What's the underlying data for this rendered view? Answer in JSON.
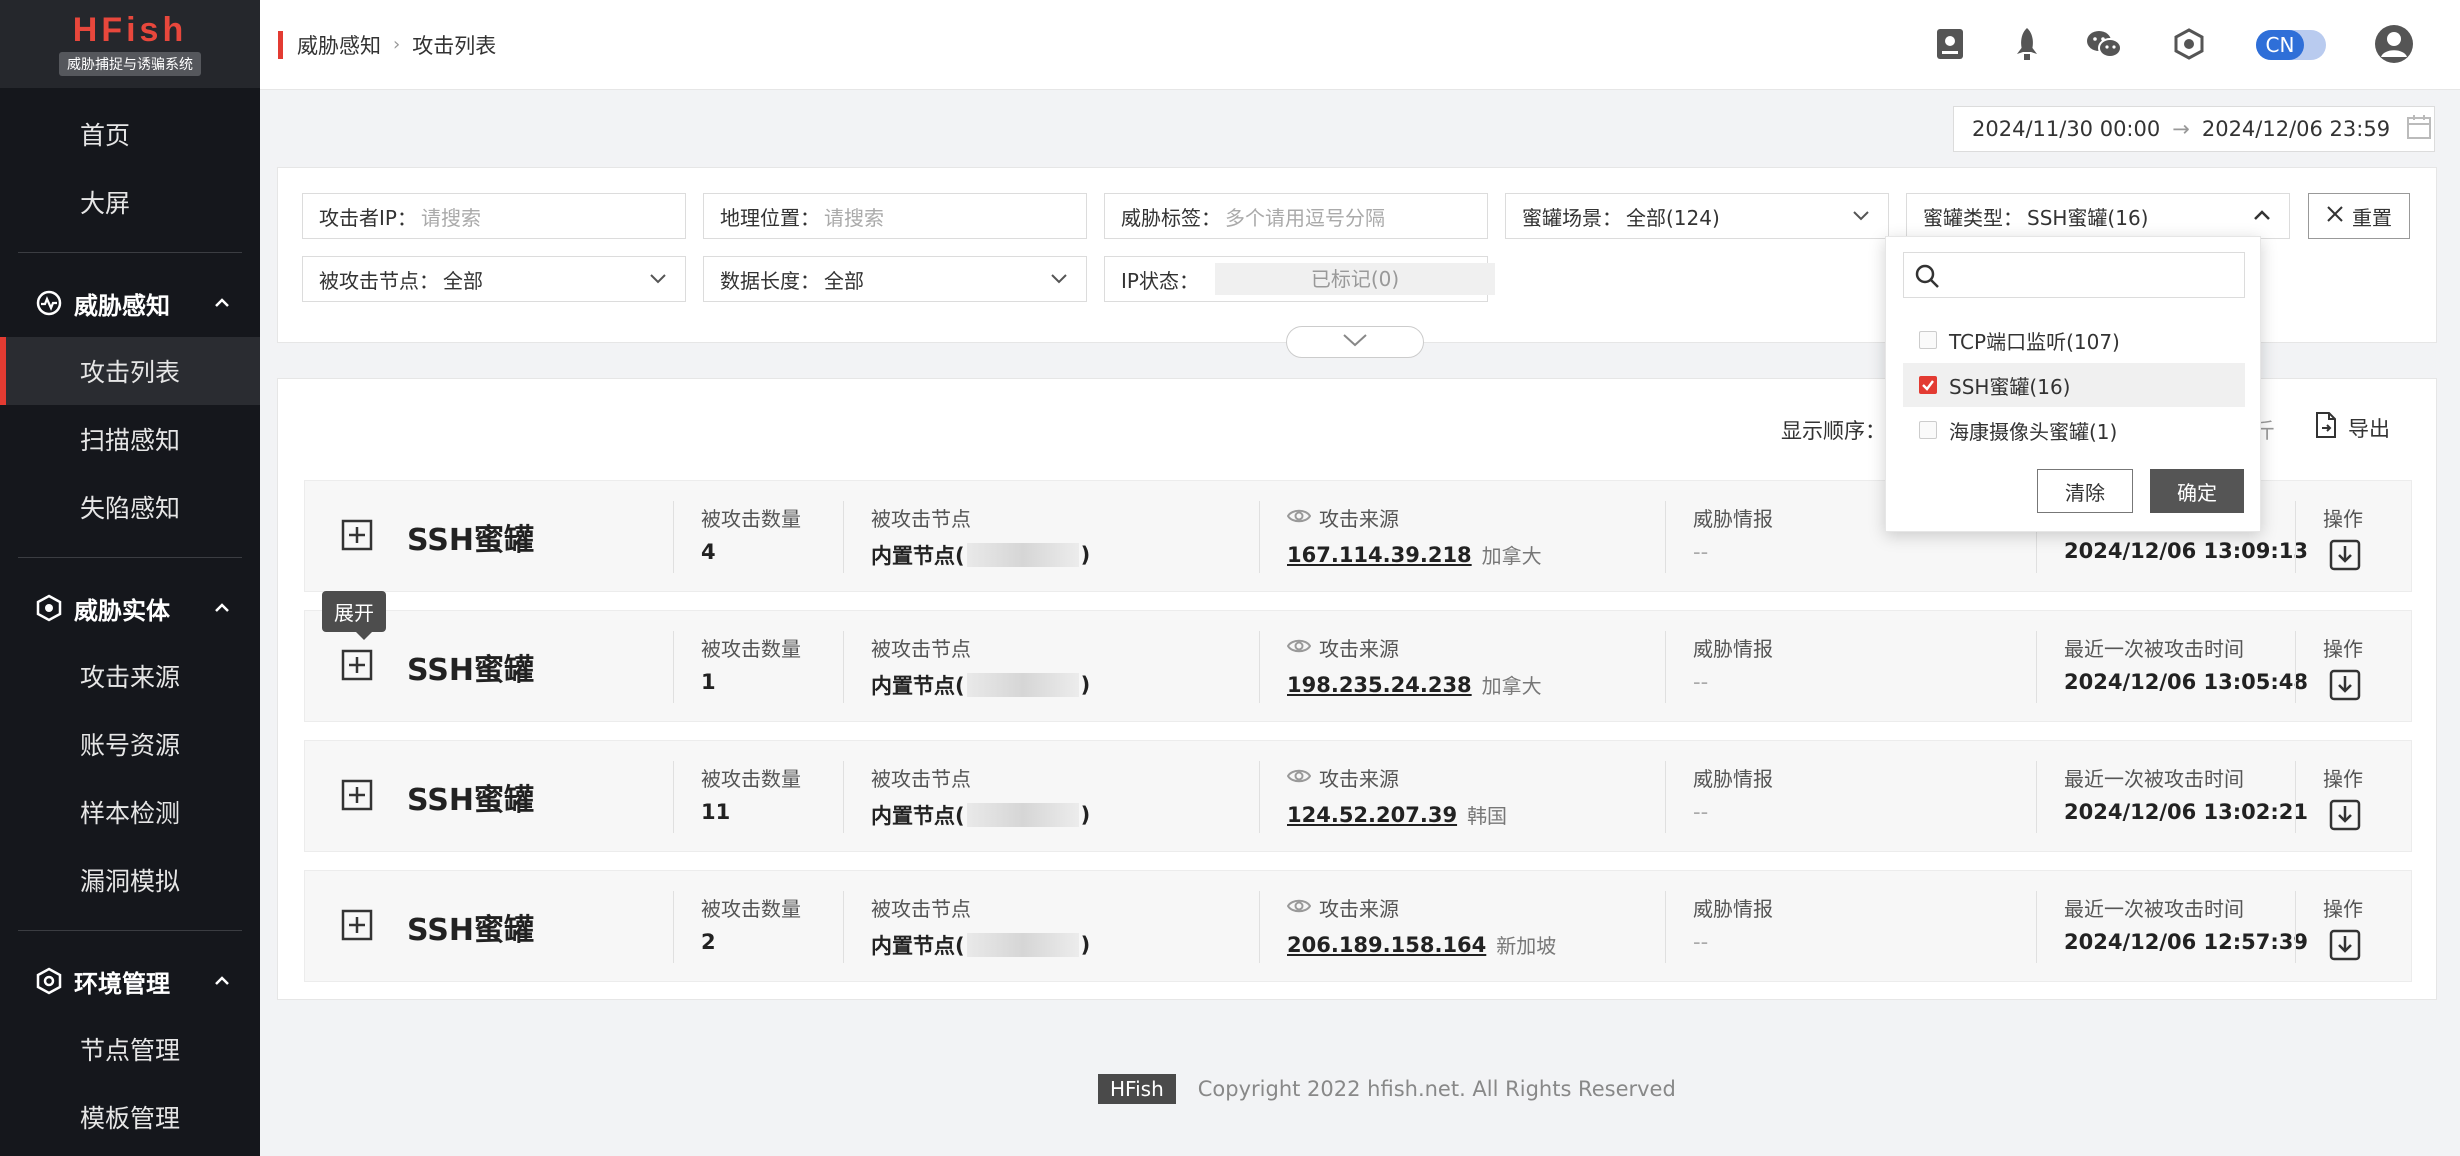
{
  "brand": {
    "title": "HFish",
    "subtitle": "威胁捕捉与诱骗系统"
  },
  "sidebar": {
    "top_items": [
      {
        "label": "首页"
      },
      {
        "label": "大屏"
      }
    ],
    "groups": [
      {
        "label": "威胁感知",
        "items": [
          {
            "label": "攻击列表",
            "active": true
          },
          {
            "label": "扫描感知"
          },
          {
            "label": "失陷感知"
          }
        ]
      },
      {
        "label": "威胁实体",
        "items": [
          {
            "label": "攻击来源"
          },
          {
            "label": "账号资源"
          },
          {
            "label": "样本检测"
          },
          {
            "label": "漏洞模拟"
          }
        ]
      },
      {
        "label": "环境管理",
        "items": [
          {
            "label": "节点管理"
          },
          {
            "label": "模板管理"
          }
        ]
      }
    ]
  },
  "header": {
    "breadcrumb": [
      "威胁感知",
      "攻击列表"
    ],
    "lang": "CN",
    "icons": [
      "manual-icon",
      "rocket-icon",
      "wechat-icon",
      "hexagon-settings-icon",
      "user-avatar-icon"
    ]
  },
  "date_range": {
    "start": "2024/11/30 00:00",
    "end": "2024/12/06 23:59"
  },
  "filters": {
    "attacker_ip": {
      "label": "攻击者IP：",
      "placeholder": "请搜索"
    },
    "geo": {
      "label": "地理位置：",
      "placeholder": "请搜索"
    },
    "threat_tag": {
      "label": "威胁标签：",
      "placeholder": "多个请用逗号分隔"
    },
    "scene": {
      "label": "蜜罐场景：",
      "value": "全部(124)"
    },
    "honeypot_type": {
      "label": "蜜罐类型：",
      "value": "SSH蜜罐(16)"
    },
    "reset_label": "重置",
    "node": {
      "label": "被攻击节点：",
      "value": "全部"
    },
    "data_length": {
      "label": "数据长度：",
      "value": "全部"
    },
    "ip_status": {
      "label": "IP状态：",
      "value": "已标记(0)"
    }
  },
  "dropdown": {
    "options": [
      {
        "label": "TCP端口监听(107)",
        "checked": false
      },
      {
        "label": "SSH蜜罐(16)",
        "checked": true
      },
      {
        "label": "海康摄像头蜜罐(1)",
        "checked": false
      }
    ],
    "clear_label": "清除",
    "confirm_label": "确定"
  },
  "list": {
    "order_label": "显示顺序：",
    "order_tail": "斤",
    "export_label": "导出",
    "tooltip": "展开",
    "headers": {
      "count": "被攻击数量",
      "node": "被攻击节点",
      "source": "攻击来源",
      "intel": "威胁情报",
      "last_time": "最近一次被攻击时间",
      "op": "操作"
    },
    "rows": [
      {
        "title": "SSH蜜罐",
        "count": "4",
        "node_prefix": "内置节点(",
        "node_suffix": ")",
        "ip": "167.114.39.218",
        "country": "加拿大",
        "intel": "--",
        "last_time": "2024/12/06 13:09:13"
      },
      {
        "title": "SSH蜜罐",
        "count": "1",
        "node_prefix": "内置节点(",
        "node_suffix": ")",
        "ip": "198.235.24.238",
        "country": "加拿大",
        "intel": "--",
        "last_time": "2024/12/06 13:05:48"
      },
      {
        "title": "SSH蜜罐",
        "count": "11",
        "node_prefix": "内置节点(",
        "node_suffix": ")",
        "ip": "124.52.207.39",
        "country": "韩国",
        "intel": "--",
        "last_time": "2024/12/06 13:02:21"
      },
      {
        "title": "SSH蜜罐",
        "count": "2",
        "node_prefix": "内置节点(",
        "node_suffix": ")",
        "ip": "206.189.158.164",
        "country": "新加坡",
        "intel": "--",
        "last_time": "2024/12/06 12:57:39"
      }
    ]
  },
  "footer": {
    "logo": "HFish",
    "copyright": "Copyright 2022 hfish.net. All Rights Reserved"
  },
  "colors": {
    "accent": "#e33b32",
    "sidebar_bg": "#15171c",
    "toggle": "#2f6fd8"
  }
}
